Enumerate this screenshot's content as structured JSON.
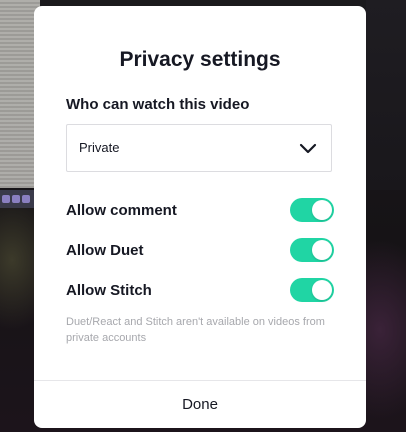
{
  "modal": {
    "title": "Privacy settings",
    "visibility": {
      "label": "Who can watch this video",
      "selected": "Private"
    },
    "toggles": [
      {
        "label": "Allow comment",
        "enabled": true
      },
      {
        "label": "Allow Duet",
        "enabled": true
      },
      {
        "label": "Allow Stitch",
        "enabled": true
      }
    ],
    "note": "Duet/React and Stitch aren't available on videos from private accounts",
    "done_label": "Done"
  },
  "colors": {
    "toggle_on": "#20d5a4",
    "text_primary": "#161823",
    "text_muted": "#a7a8ad"
  },
  "icons": {
    "select_chevron": "chevron-down-icon"
  }
}
